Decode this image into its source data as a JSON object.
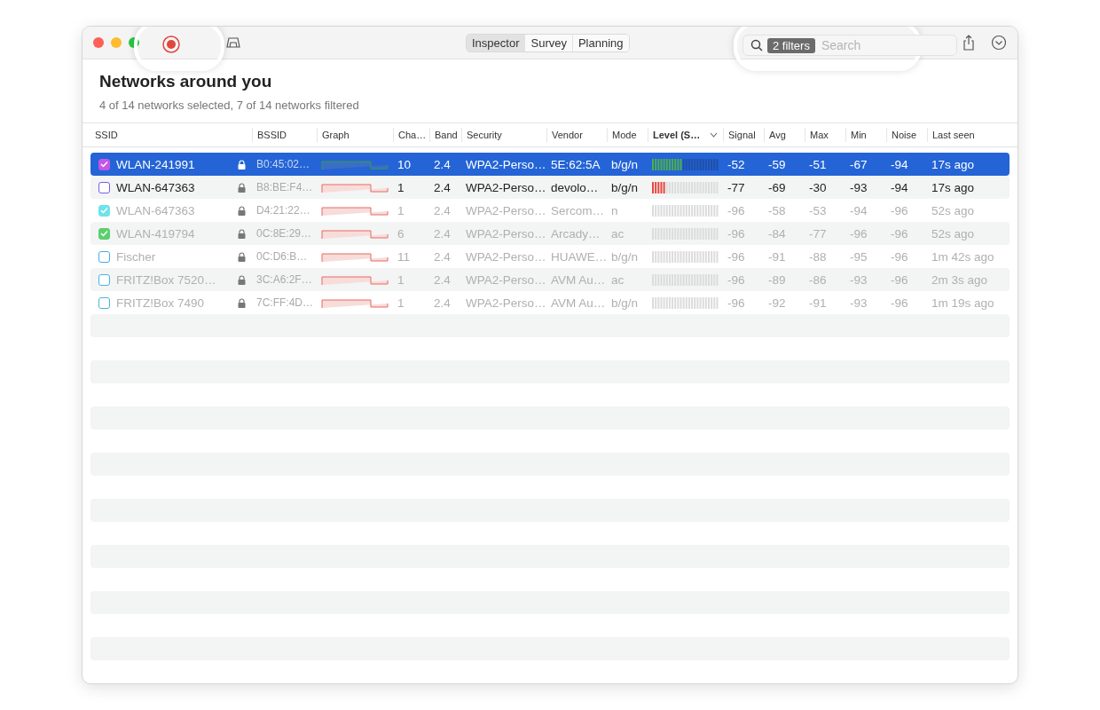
{
  "toolbar": {
    "tabs": [
      {
        "label": "Inspector",
        "selected": true
      },
      {
        "label": "Survey",
        "selected": false
      },
      {
        "label": "Planning",
        "selected": false
      }
    ],
    "filter_badge": "2 filters",
    "search": {
      "placeholder": "Search"
    },
    "recording": true
  },
  "header": {
    "title": "Networks around you",
    "subtitle": "4 of 14 networks selected, 7 of 14 networks filtered"
  },
  "table": {
    "columns": [
      {
        "label": "SSID",
        "sorted": false
      },
      {
        "label": "BSSID",
        "sorted": false
      },
      {
        "label": "Graph",
        "sorted": false
      },
      {
        "label": "Cha…",
        "sorted": false
      },
      {
        "label": "Band",
        "sorted": false
      },
      {
        "label": "Security",
        "sorted": false
      },
      {
        "label": "Vendor",
        "sorted": false
      },
      {
        "label": "Mode",
        "sorted": false
      },
      {
        "label": "Level (S…",
        "sorted": true
      },
      {
        "label": "Signal",
        "sorted": false
      },
      {
        "label": "Avg",
        "sorted": false
      },
      {
        "label": "Max",
        "sorted": false
      },
      {
        "label": "Min",
        "sorted": false
      },
      {
        "label": "Noise",
        "sorted": false
      },
      {
        "label": "Last seen",
        "sorted": false
      }
    ],
    "rows": [
      {
        "selected": true,
        "checked": true,
        "color": "#c455e8",
        "dimmed": false,
        "level": 0.47,
        "ssid": "WLAN-241991",
        "bssid": "B0:45:02…",
        "channel": "10",
        "band": "2.4",
        "security": "WPA2-Perso…",
        "vendor": "5E:62:5A",
        "mode": "b/g/n",
        "signal": "-52",
        "avg": "-59",
        "max": "-51",
        "min": "-67",
        "noise": "-94",
        "last_seen": "17s ago"
      },
      {
        "selected": false,
        "checked": false,
        "color": "#7b5cf0",
        "dimmed": false,
        "level": 0.2,
        "ssid": "WLAN-647363",
        "bssid": "B8:BE:F4…",
        "channel": "1",
        "band": "2.4",
        "security": "WPA2-Perso…",
        "vendor": "devolo…",
        "mode": "b/g/n",
        "signal": "-77",
        "avg": "-69",
        "max": "-30",
        "min": "-93",
        "noise": "-94",
        "last_seen": "17s ago"
      },
      {
        "selected": false,
        "checked": true,
        "color": "#6fe3ea",
        "dimmed": true,
        "level": 0,
        "ssid": "WLAN-647363",
        "bssid": "D4:21:22…",
        "channel": "1",
        "band": "2.4",
        "security": "WPA2-Perso…",
        "vendor": "Sercom…",
        "mode": "n",
        "signal": "-96",
        "avg": "-58",
        "max": "-53",
        "min": "-94",
        "noise": "-96",
        "last_seen": "52s ago"
      },
      {
        "selected": false,
        "checked": true,
        "color": "#5ccf6e",
        "dimmed": true,
        "level": 0,
        "ssid": "WLAN-419794",
        "bssid": "0C:8E:29…",
        "channel": "6",
        "band": "2.4",
        "security": "WPA2-Perso…",
        "vendor": "Arcady…",
        "mode": "ac",
        "signal": "-96",
        "avg": "-84",
        "max": "-77",
        "min": "-96",
        "noise": "-96",
        "last_seen": "52s ago"
      },
      {
        "selected": false,
        "checked": false,
        "color": "#4aa8f0",
        "dimmed": true,
        "level": 0,
        "ssid": "Fischer",
        "bssid": "0C:D6:B…",
        "channel": "11",
        "band": "2.4",
        "security": "WPA2-Perso…",
        "vendor": "HUAWE…",
        "mode": "b/g/n",
        "signal": "-96",
        "avg": "-91",
        "max": "-88",
        "min": "-95",
        "noise": "-96",
        "last_seen": "1m 42s ago"
      },
      {
        "selected": false,
        "checked": false,
        "color": "#47b5dc",
        "dimmed": true,
        "level": 0,
        "ssid": "FRITZ!Box 7520…",
        "bssid": "3C:A6:2F…",
        "channel": "1",
        "band": "2.4",
        "security": "WPA2-Perso…",
        "vendor": "AVM Au…",
        "mode": "ac",
        "signal": "-96",
        "avg": "-89",
        "max": "-86",
        "min": "-93",
        "noise": "-96",
        "last_seen": "2m 3s ago"
      },
      {
        "selected": false,
        "checked": false,
        "color": "#48b8d0",
        "dimmed": true,
        "level": 0,
        "ssid": "FRITZ!Box 7490",
        "bssid": "7C:FF:4D…",
        "channel": "1",
        "band": "2.4",
        "security": "WPA2-Perso…",
        "vendor": "AVM Au…",
        "mode": "b/g/n",
        "signal": "-96",
        "avg": "-92",
        "max": "-91",
        "min": "-93",
        "noise": "-96",
        "last_seen": "1m 19s ago"
      }
    ]
  }
}
